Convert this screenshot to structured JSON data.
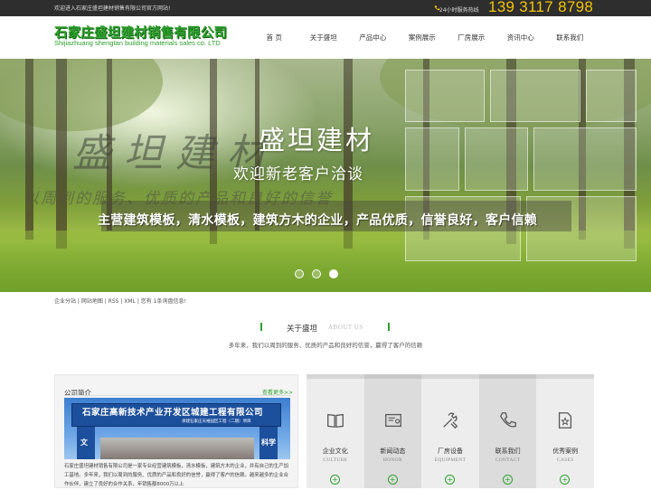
{
  "topbar": {
    "welcome": "欢迎进入石家庄盛坦建材销售有限公司官方网站!",
    "hotline_label": "24小时服务热线",
    "phone": "139 3117 8798"
  },
  "header": {
    "logo_cn": "石家庄盛坦建材销售有限公司",
    "logo_en": "Shijiazhuang shengtan building materials sales co. LTD"
  },
  "nav": [
    "首 页",
    "关于盛坦",
    "产品中心",
    "案例展示",
    "厂房展示",
    "资讯中心",
    "联系我们"
  ],
  "banner": {
    "ghost_title": "盛坦建材",
    "ghost_sub": "以周到的服务、优质的产品和良好的信誉",
    "title": "盛坦建材",
    "subtitle": "欢迎新老客户洽谈",
    "strip": "主营建筑模板，清水模板，建筑方木的企业，产品优质，信誉良好，客户信赖",
    "slide_count": 3,
    "active_slide": 3
  },
  "links": "企业分站 | 网站地图 | RSS | XML | 您有 1条询盘信息!",
  "about": {
    "title": "关于盛坦",
    "title_en": "ABOUT US",
    "desc": "多年来，我们以周到的服务、优质的产品和良好的信誉，赢得了客户的信赖"
  },
  "intro": {
    "title": "公司简介",
    "more": "查看更多>>",
    "image_gate_text": "石家庄高新技术产业开发区城建工程有限公司",
    "image_gate_small": "承建石家庄天裕园区工程（二期）项目",
    "image_left_text": "文",
    "image_right_text": "科学",
    "text": "石家庄盛坦建材销售有限公司是一家专业经营建筑模板，清水模板，建筑方木的企业，并有自己的生产加工基地。多年来，我们以周到的服务、优质的产品和良好的信誉，赢得了客户的信赖。越来越多的企业合作伙伴，建立了良好的合作关系，年销售额8000万以上"
  },
  "panel": [
    {
      "label": "企业文化",
      "en": "CULTURE",
      "icon": "book-icon"
    },
    {
      "label": "新闻动态",
      "en": "HONOR",
      "icon": "certificate-icon"
    },
    {
      "label": "厂房设备",
      "en": "EQUIPMENT",
      "icon": "tools-icon"
    },
    {
      "label": "联系我们",
      "en": "CONTACT",
      "icon": "phone-icon"
    },
    {
      "label": "优秀案例",
      "en": "CASES",
      "icon": "star-doc-icon"
    }
  ],
  "colors": {
    "brand_green": "#2ea12e",
    "phone_yellow": "#f5c400",
    "topbar_bg": "#2e2e2e"
  }
}
